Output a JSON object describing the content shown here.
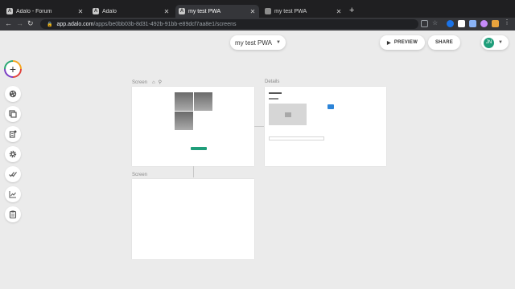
{
  "browser": {
    "tabs": [
      {
        "title": "Adalo - Forum",
        "favicon": "A"
      },
      {
        "title": "Adalo",
        "favicon": "A"
      },
      {
        "title": "my test PWA",
        "favicon": "A"
      },
      {
        "title": "my test PWA",
        "favicon": ""
      }
    ],
    "close_glyph": "✕",
    "new_tab_glyph": "+",
    "url_host": "app.adalo.com",
    "url_path": "/apps/be0bb03b-8d31-492b-91bb-e89dcf7aa8e1/screens",
    "back_glyph": "←",
    "forward_glyph": "→",
    "reload_glyph": "↻",
    "lock_glyph": "🔒"
  },
  "header": {
    "app_name": "my test PWA",
    "dropdown_glyph": "▼",
    "preview_label": "PREVIEW",
    "preview_glyph": "▶",
    "share_label": "SHARE",
    "avatar_initials": "JN"
  },
  "toolbar": {
    "add_glyph": "+"
  },
  "canvas": {
    "screens": [
      {
        "label": "Screen",
        "home_glyph": "⌂",
        "user_glyph": "⚲"
      },
      {
        "label": "Details"
      },
      {
        "label": "Screen"
      }
    ]
  },
  "colors": {
    "brand_green": "#1f9e7a",
    "accent_blue": "#2c84d8"
  }
}
